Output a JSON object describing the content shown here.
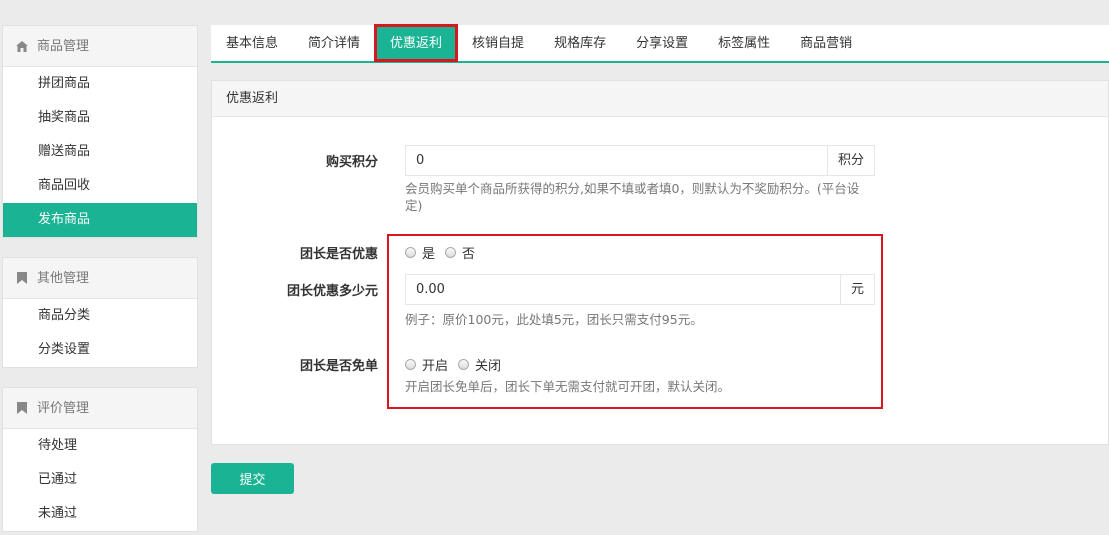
{
  "sidebar": {
    "sections": [
      {
        "title": "商品管理",
        "icon": "home-icon",
        "items": [
          "拼团商品",
          "抽奖商品",
          "赠送商品",
          "商品回收",
          "发布商品"
        ],
        "active_index": 4
      },
      {
        "title": "其他管理",
        "icon": "bookmark-icon",
        "items": [
          "商品分类",
          "分类设置"
        ]
      },
      {
        "title": "评价管理",
        "icon": "bookmark-icon",
        "items": [
          "待处理",
          "已通过",
          "未通过"
        ]
      }
    ]
  },
  "tabs": [
    "基本信息",
    "简介详情",
    "优惠返利",
    "核销自提",
    "规格库存",
    "分享设置",
    "标签属性",
    "商品营销"
  ],
  "active_tab": "优惠返利",
  "card": {
    "title": "优惠返利",
    "points": {
      "label": "购买积分",
      "value": "0",
      "addon": "积分",
      "help": "会员购买单个商品所获得的积分,如果不填或者填0，则默认为不奖励积分。(平台设定)"
    },
    "leader_discount": {
      "label": "团长是否优惠",
      "options": [
        "是",
        "否"
      ]
    },
    "leader_amount": {
      "label": "团长优惠多少元",
      "value": "0.00",
      "addon": "元",
      "help": "例子：原价100元，此处填5元，团长只需支付95元。"
    },
    "leader_free": {
      "label": "团长是否免单",
      "options": [
        "开启",
        "关闭"
      ],
      "help": "开启团长免单后，团长下单无需支付就可开团，默认关闭。"
    }
  },
  "submit_label": "提交",
  "colors": {
    "accent": "#1ab394",
    "highlight": "#d9161d"
  }
}
